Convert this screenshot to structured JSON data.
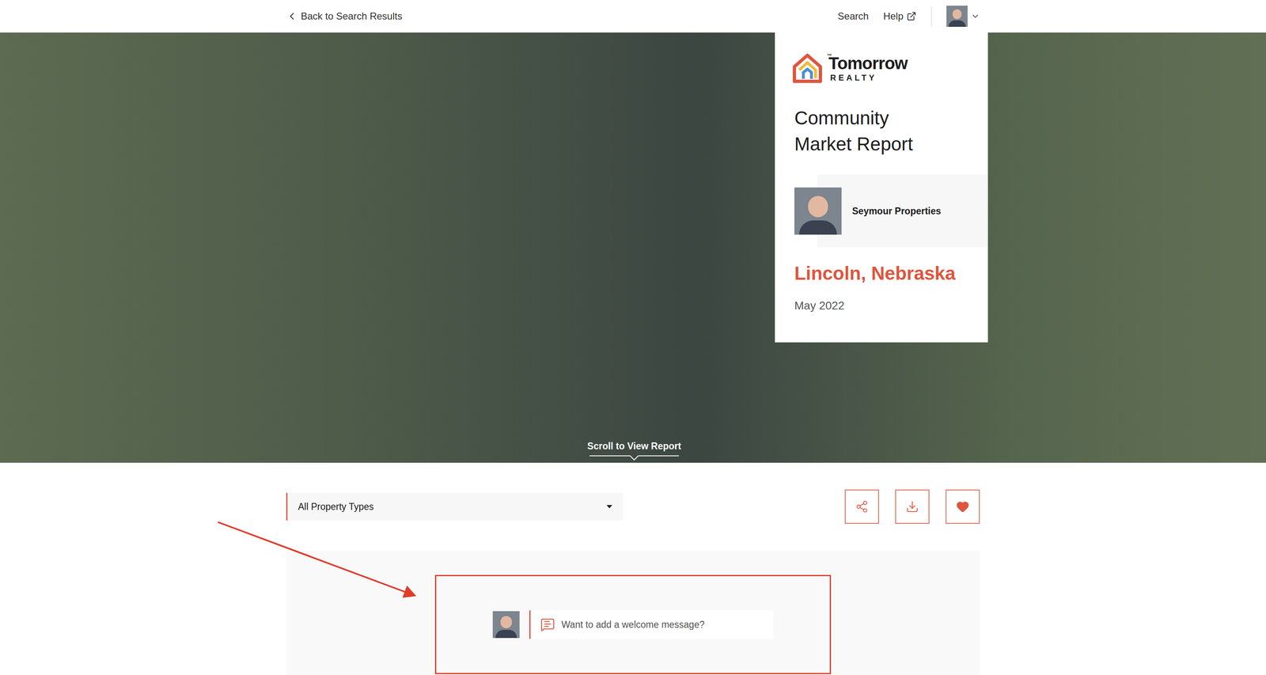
{
  "top_bar": {
    "back": "Back to Search Results",
    "nav": [
      {
        "label": "Search",
        "external": false
      },
      {
        "label": "Help",
        "external": true
      }
    ]
  },
  "hero": {
    "scroll_hint": "Scroll to View Report"
  },
  "card": {
    "brand": {
      "name": "Tomorrow",
      "sub": "REALTY",
      "mark": "™"
    },
    "title": [
      "Community",
      "Market Report"
    ],
    "agent": "Seymour Properties",
    "location": "Lincoln, Nebraska",
    "date": "May 2022"
  },
  "filter": {
    "value": "All Property Types"
  },
  "actions": [
    {
      "name": "share",
      "active": false
    },
    {
      "name": "download",
      "active": false
    },
    {
      "name": "favorite",
      "active": true
    }
  ],
  "welcome": {
    "placeholder": "Want to add a welcome message?"
  }
}
